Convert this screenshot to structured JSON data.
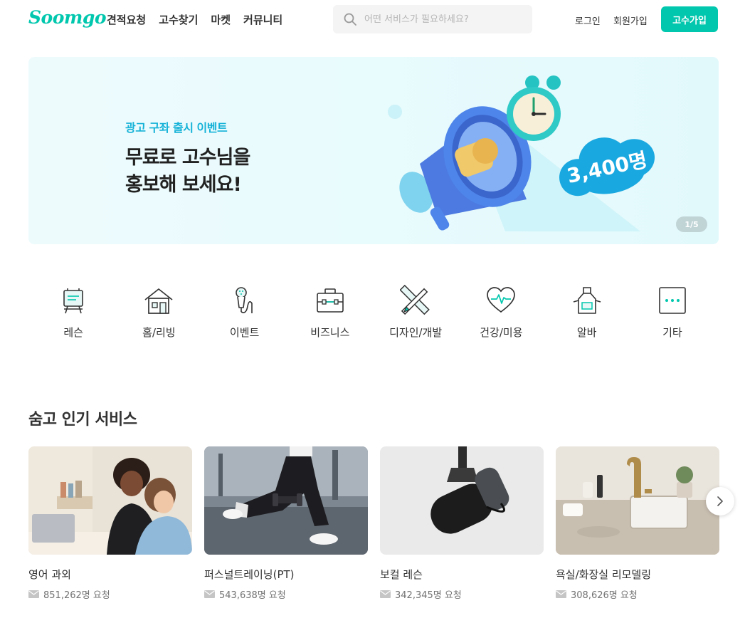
{
  "header": {
    "logo": "Soomgo",
    "nav": [
      "견적요청",
      "고수찾기",
      "마켓",
      "커뮤니티"
    ],
    "search_placeholder": "어떤 서비스가 필요하세요?",
    "login": "로그인",
    "signup": "회원가입",
    "pro_signup": "고수가입"
  },
  "banner": {
    "subtitle": "광고 구좌 출시 이벤트",
    "title_line1": "무료로 고수님을",
    "title_line2": "홍보해 보세요!",
    "badge": "3,400명",
    "pager": "1/5"
  },
  "categories": [
    {
      "label": "레슨",
      "icon": "easel-icon"
    },
    {
      "label": "홈/리빙",
      "icon": "house-icon"
    },
    {
      "label": "이벤트",
      "icon": "microphone-icon"
    },
    {
      "label": "비즈니스",
      "icon": "briefcase-icon"
    },
    {
      "label": "디자인/개발",
      "icon": "pencil-ruler-icon"
    },
    {
      "label": "건강/미용",
      "icon": "heart-pulse-icon"
    },
    {
      "label": "알바",
      "icon": "apron-icon"
    },
    {
      "label": "기타",
      "icon": "more-icon"
    }
  ],
  "popular": {
    "title": "숨고 인기 서비스",
    "cards": [
      {
        "title": "영어 과외",
        "count": "851,262명 요청"
      },
      {
        "title": "퍼스널트레이닝(PT)",
        "count": "543,638명 요청"
      },
      {
        "title": "보컬 레슨",
        "count": "342,345명 요청"
      },
      {
        "title": "욕실/화장실 리모델링",
        "count": "308,626명 요청"
      }
    ]
  },
  "colors": {
    "brand": "#00c7ae",
    "banner_accent": "#15b2d8",
    "text": "#323232"
  }
}
